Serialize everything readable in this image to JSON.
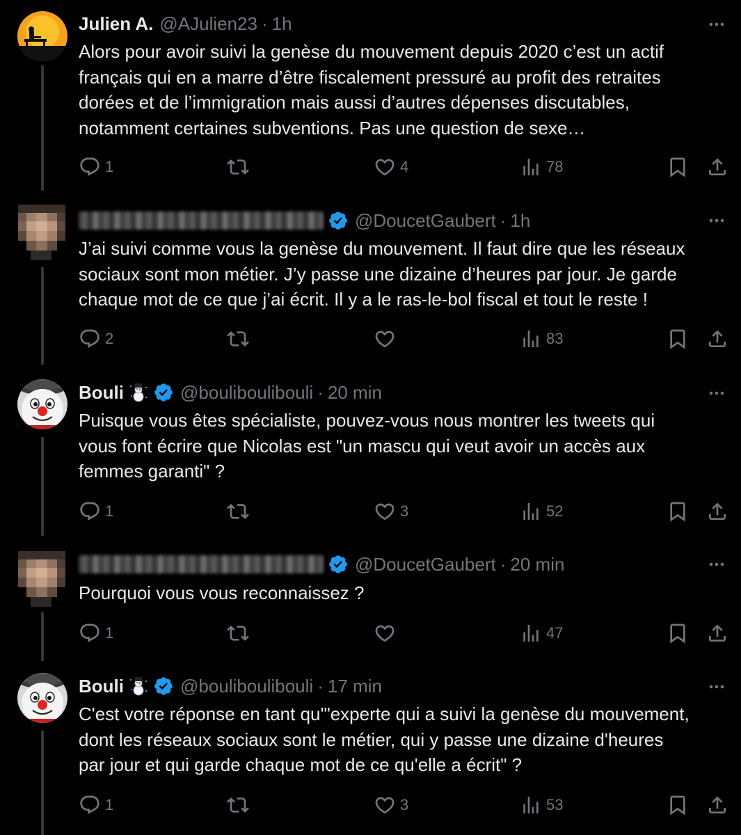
{
  "tweets": [
    {
      "name": "Julien A.",
      "name_hidden": false,
      "emoji": "",
      "verified": false,
      "handle": "@AJulien23",
      "time": "1h",
      "text": "Alors pour avoir suivi la genèse du mouvement depuis 2020 c’est un actif\nfrançais qui en a marre d’être fiscalement pressuré au profit des retraites\ndorées et de l’immigration mais aussi d’autres dépenses discutables,\nnotamment certaines subventions.  Pas une question de sexe…",
      "replies": "1",
      "retweets": "",
      "likes": "4",
      "views": "78",
      "avatar": "sunset-bench-avatar"
    },
    {
      "name": "",
      "name_hidden": true,
      "emoji": "",
      "verified": true,
      "handle": "@DoucetGaubert",
      "time": "1h",
      "text": "J’ai suivi comme vous la genèse du mouvement. Il faut dire que les réseaux\nsociaux sont mon métier. J’y passe une dizaine d’heures par jour. Je garde\nchaque mot de ce que j’ai écrit. Il y a le ras-le-bol fiscal et tout le reste !",
      "replies": "2",
      "retweets": "",
      "likes": "",
      "views": "83",
      "avatar": "pixelated-avatar"
    },
    {
      "name": "Bouli",
      "name_hidden": false,
      "emoji": "snowman-emoji",
      "verified": true,
      "handle": "@bouliboulibouli",
      "time": "20 min",
      "text": "Puisque vous êtes spécialiste, pouvez-vous nous montrer les tweets qui\nvous font écrire que Nicolas est \"un mascu qui veut avoir un accès aux\nfemmes garanti\" ?",
      "replies": "1",
      "retweets": "",
      "likes": "3",
      "views": "52",
      "avatar": "snowman-avatar"
    },
    {
      "name": "",
      "name_hidden": true,
      "emoji": "",
      "verified": true,
      "handle": "@DoucetGaubert",
      "time": "20 min",
      "text": "Pourquoi vous vous reconnaissez ?",
      "replies": "1",
      "retweets": "",
      "likes": "",
      "views": "47",
      "avatar": "pixelated-avatar"
    },
    {
      "name": "Bouli",
      "name_hidden": false,
      "emoji": "snowman-emoji",
      "verified": true,
      "handle": "@bouliboulibouli",
      "time": "17 min",
      "text": "C'est votre réponse en tant qu'\"experte qui a suivi la genèse du mouvement,\ndont les réseaux sociaux sont le métier, qui y passe une dizaine d'heures\npar jour et qui garde chaque mot de ce qu'elle a écrit\" ?",
      "replies": "1",
      "retweets": "",
      "likes": "3",
      "views": "53",
      "avatar": "snowman-avatar"
    }
  ],
  "colors": {
    "background": "#000000",
    "text": "#e7e9ea",
    "muted": "#71767b",
    "verified": "#1d9bf0",
    "thread_line": "#333639"
  }
}
